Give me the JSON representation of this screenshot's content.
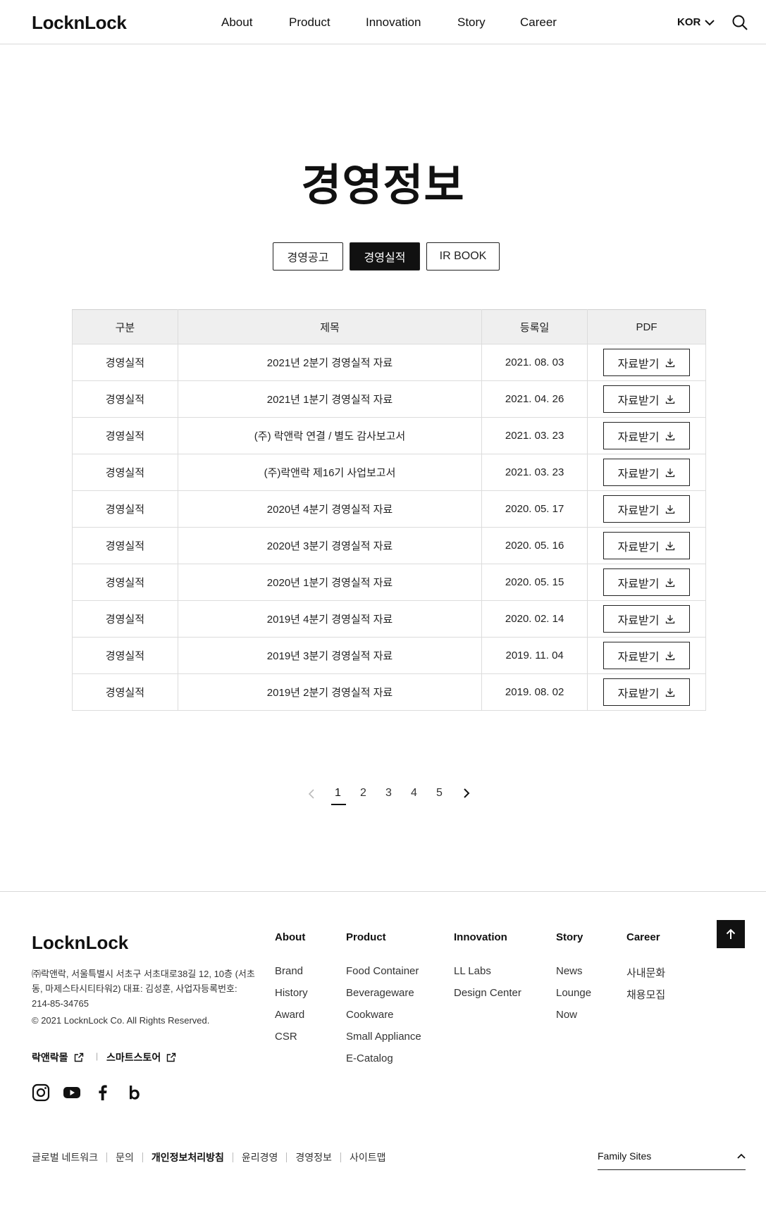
{
  "header": {
    "logo": "LocknLock",
    "nav": [
      "About",
      "Product",
      "Innovation",
      "Story",
      "Career"
    ],
    "language": "KOR"
  },
  "page": {
    "title": "경영정보",
    "tabs": [
      {
        "label": "경영공고",
        "active": false
      },
      {
        "label": "경영실적",
        "active": true
      },
      {
        "label": "IR BOOK",
        "active": false
      }
    ]
  },
  "table": {
    "headers": [
      "구분",
      "제목",
      "등록일",
      "PDF"
    ],
    "download_label": "자료받기",
    "rows": [
      {
        "category": "경영실적",
        "title": "2021년 2분기 경영실적 자료",
        "date": "2021. 08. 03"
      },
      {
        "category": "경영실적",
        "title": "2021년 1분기 경영실적 자료",
        "date": "2021. 04. 26"
      },
      {
        "category": "경영실적",
        "title": "(주) 락앤락 연결 / 별도 감사보고서",
        "date": "2021. 03. 23"
      },
      {
        "category": "경영실적",
        "title": "(주)락앤락 제16기 사업보고서",
        "date": "2021. 03. 23"
      },
      {
        "category": "경영실적",
        "title": "2020년 4분기 경영실적 자료",
        "date": "2020. 05. 17"
      },
      {
        "category": "경영실적",
        "title": "2020년 3분기 경영실적 자료",
        "date": "2020. 05. 16"
      },
      {
        "category": "경영실적",
        "title": "2020년 1분기 경영실적 자료",
        "date": "2020. 05. 15"
      },
      {
        "category": "경영실적",
        "title": "2019년 4분기 경영실적 자료",
        "date": "2020. 02. 14"
      },
      {
        "category": "경영실적",
        "title": "2019년 3분기 경영실적 자료",
        "date": "2019. 11. 04"
      },
      {
        "category": "경영실적",
        "title": "2019년 2분기 경영실적 자료",
        "date": "2019. 08. 02"
      }
    ]
  },
  "pagination": {
    "pages": [
      "1",
      "2",
      "3",
      "4",
      "5"
    ],
    "current": "1"
  },
  "footer": {
    "logo": "LocknLock",
    "address": "㈜락앤락, 서울특별시 서초구 서초대로38길 12, 10층 (서초동, 마제스타시티타워2) 대표: 김성훈, 사업자등록번호: 214-85-34765",
    "copyright": "© 2021 LocknLock Co. All Rights Reserved.",
    "shops": [
      "락앤락몰",
      "스마트스토어"
    ],
    "sns": [
      "instagram-icon",
      "youtube-icon",
      "facebook-icon",
      "blog-icon"
    ],
    "columns": [
      {
        "heading": "About",
        "items": [
          "Brand",
          "History",
          "Award",
          "CSR"
        ]
      },
      {
        "heading": "Product",
        "items": [
          "Food Container",
          "Beverageware",
          "Cookware",
          "Small Appliance",
          "E-Catalog"
        ]
      },
      {
        "heading": "Innovation",
        "items": [
          "LL Labs",
          "Design Center"
        ]
      },
      {
        "heading": "Story",
        "items": [
          "News",
          "Lounge",
          "Now"
        ]
      },
      {
        "heading": "Career",
        "items": [
          "사내문화",
          "채용모집"
        ]
      }
    ],
    "bottom_links": [
      {
        "label": "글로벌 네트워크",
        "strong": false
      },
      {
        "label": "문의",
        "strong": false
      },
      {
        "label": "개인정보처리방침",
        "strong": true
      },
      {
        "label": "윤리경영",
        "strong": false
      },
      {
        "label": "경영정보",
        "strong": false
      },
      {
        "label": "사이트맵",
        "strong": false
      }
    ],
    "family_sites": "Family Sites"
  }
}
